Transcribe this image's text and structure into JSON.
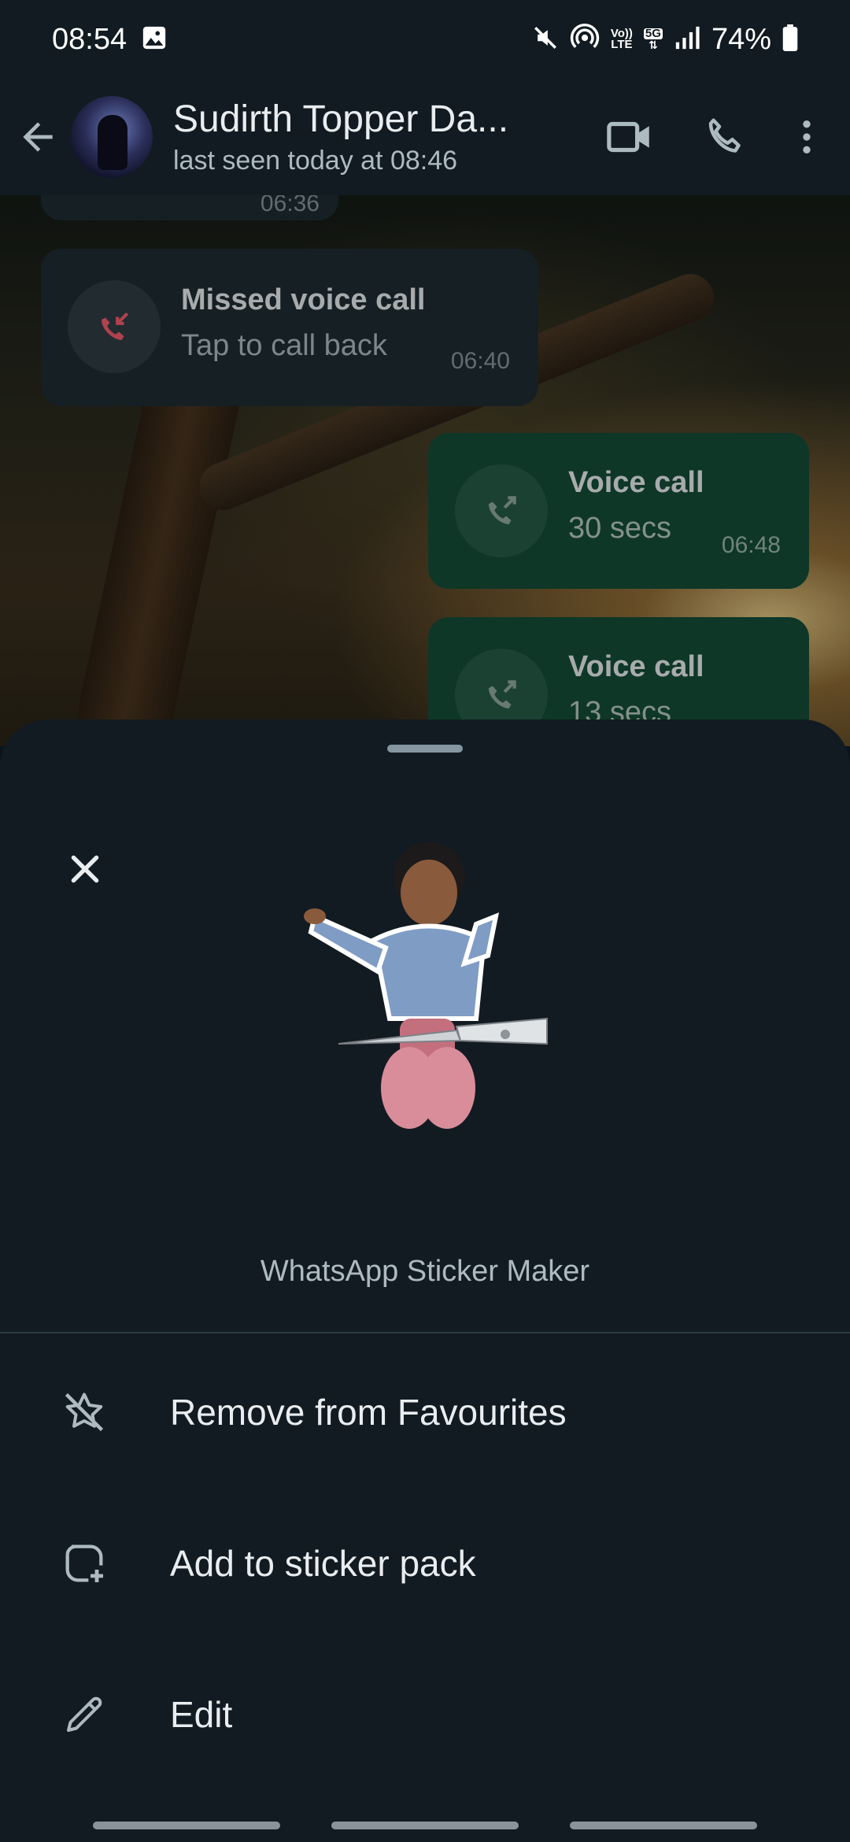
{
  "status_bar": {
    "time": "08:54",
    "volte_top": "Vo))",
    "volte_bottom": "LTE",
    "network": "5G",
    "battery": "74%"
  },
  "header": {
    "contact_name": "Sudirth Topper Da...",
    "last_seen": "last seen today at 08:46",
    "icons": [
      "back-arrow-icon",
      "video-call-icon",
      "phone-icon",
      "more-vert-icon"
    ]
  },
  "chat": {
    "partial_time": "06:36",
    "messages": [
      {
        "direction": "in",
        "title": "Missed voice call",
        "subtitle": "Tap to call back",
        "time": "06:40",
        "icon": "missed-call-icon",
        "icon_color": "#f15c6d"
      },
      {
        "direction": "out",
        "title": "Voice call",
        "subtitle": "30 secs",
        "time": "06:48",
        "icon": "outgoing-call-icon"
      },
      {
        "direction": "out",
        "title": "Voice call",
        "subtitle": "13 secs",
        "time": "",
        "icon": "outgoing-call-icon"
      }
    ]
  },
  "sheet": {
    "sticker_source": "WhatsApp Sticker Maker",
    "menu": [
      {
        "label": "Remove from Favourites",
        "icon": "star-off-icon"
      },
      {
        "label": "Add to sticker pack",
        "icon": "add-sticker-icon"
      },
      {
        "label": "Edit",
        "icon": "pencil-icon"
      }
    ]
  },
  "colors": {
    "incoming_bubble": "#1f2c33",
    "outgoing_bubble": "#144d37",
    "sheet_bg": "#121b22",
    "missed_call_red": "#f15c6d"
  }
}
